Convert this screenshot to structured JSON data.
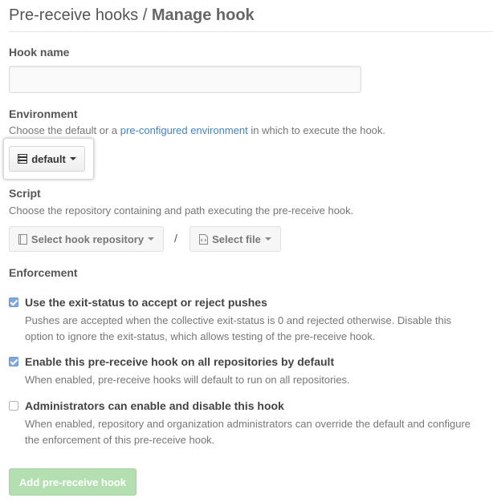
{
  "header": {
    "title_prefix": "Pre-receive hooks / ",
    "title_strong": "Manage hook"
  },
  "hook_name": {
    "label": "Hook name",
    "value": "",
    "placeholder": ""
  },
  "environment": {
    "label": "Environment",
    "note_before": "Choose the default or a ",
    "note_link": "pre-configured environment",
    "note_after": " in which to execute the hook.",
    "button_label": "default",
    "button_icon": "server-icon"
  },
  "script": {
    "label": "Script",
    "note": "Choose the repository containing and path executing the pre-receive hook.",
    "repo_button_label": "Select hook repository",
    "repo_button_icon": "repo-icon",
    "separator": "/",
    "file_button_label": "Select file",
    "file_button_icon": "file-code-icon"
  },
  "enforcement": {
    "label": "Enforcement",
    "options": [
      {
        "title": "Use the exit-status to accept or reject pushes",
        "description": "Pushes are accepted when the collective exit-status is 0 and rejected otherwise. Disable this option to ignore the exit-status, which allows testing of the pre-receive hook.",
        "checked": true
      },
      {
        "title": "Enable this pre-receive hook on all repositories by default",
        "description": "When enabled, pre-receive hooks will default to run on all repositories.",
        "checked": true
      },
      {
        "title": "Administrators can enable and disable this hook",
        "description": "When enabled, repository and organization administrators can override the default and configure the enforcement of this pre-receive hook.",
        "checked": false
      }
    ]
  },
  "submit": {
    "label": "Add pre-receive hook",
    "disabled": true
  },
  "colors": {
    "link": "#4183c4",
    "checkbox_checked": "#7fa8dc",
    "submit_disabled": "#b4e0b1"
  }
}
